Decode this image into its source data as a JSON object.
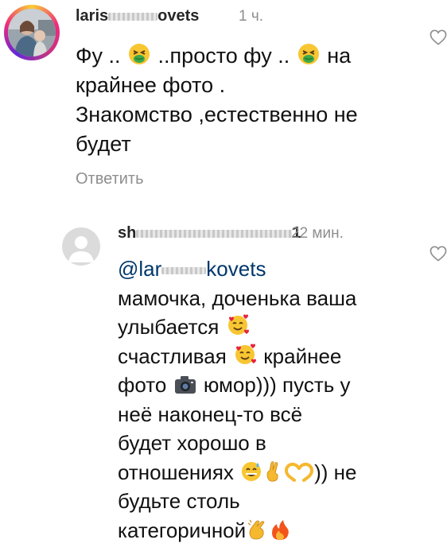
{
  "comments": [
    {
      "username_prefix": "laris",
      "username_suffix": "ovets",
      "time": "1 ч.",
      "text_lines": [
        [
          "Фу .. ",
          "nauseated-face-emoji",
          " ..просто фу .. ",
          "nauseated-face-emoji",
          " на"
        ],
        [
          "крайнее фото ."
        ],
        [
          "Знакомство ,естественно не"
        ],
        [
          "будет"
        ]
      ],
      "reply_label": "Ответить"
    },
    {
      "username_prefix": "sh",
      "username_suffix": "1",
      "time": "22 мин.",
      "mention_prefix": "@lar",
      "mention_suffix": "kovets",
      "line1": "мамочка, доченька ваша",
      "line2": "улыбается",
      "line3a": "счастливая",
      "line3b": "крайнее",
      "line4a": "фото",
      "line4b": "юмор))) пусть у",
      "line5": "неё наконец-то всё",
      "line6": "будет хорошо в",
      "line7a": "отношениях",
      "line7b": ")) не",
      "line8": "будьте столь",
      "line9": "категоричной"
    }
  ],
  "icons": {
    "like": "heart-outline-icon",
    "emojis": [
      "nauseated-face-emoji",
      "smiling-face-with-hearts-emoji",
      "camera-emoji",
      "grinning-sweat-emoji",
      "crossed-fingers-emoji",
      "heart-hands-emoji",
      "clapping-hands-emoji",
      "fire-emoji"
    ]
  },
  "colors": {
    "text": "#111111",
    "muted": "#8e8e8e",
    "mention": "#00376b"
  }
}
